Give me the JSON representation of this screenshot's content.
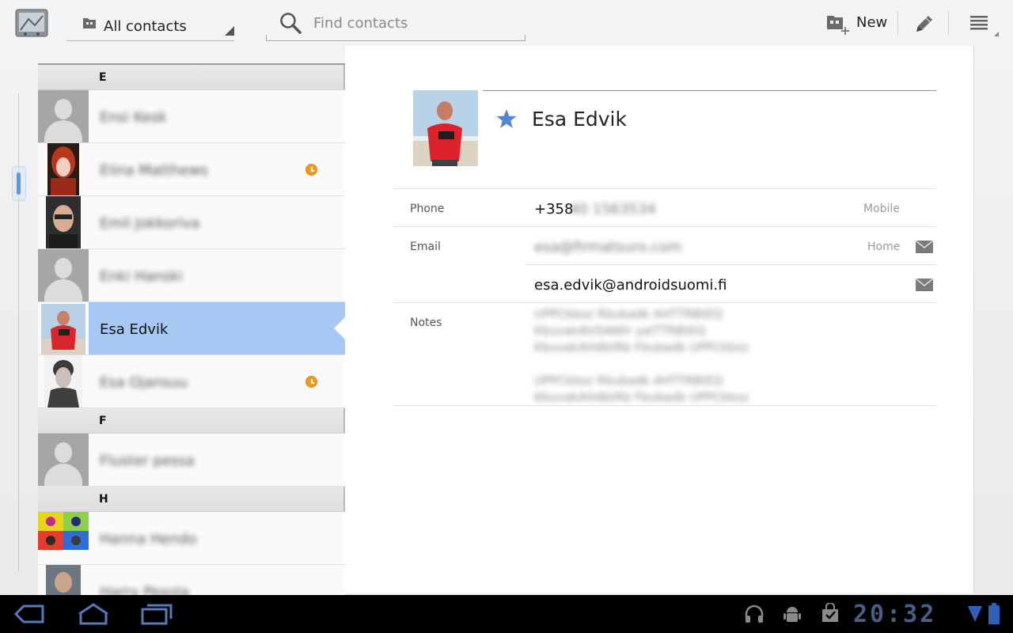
{
  "actionbar": {
    "account_filter": "All contacts",
    "search_placeholder": "Find contacts",
    "new_label": "New"
  },
  "list": {
    "sections": [
      {
        "letter": "E"
      },
      {
        "letter": "F"
      },
      {
        "letter": "H"
      }
    ],
    "rows_e": [
      {
        "name": "Ensi Kesk"
      },
      {
        "name": "Elina Matthews"
      },
      {
        "name": "Emil Jokkoriva"
      },
      {
        "name": "Enki Hanski"
      },
      {
        "name": "Esa Edvik"
      },
      {
        "name": "Esa Ojansuu"
      }
    ],
    "rows_f": [
      {
        "name": "Fluster pessa"
      }
    ],
    "rows_h": [
      {
        "name": "Hanna Hendo"
      },
      {
        "name": "Harry Pesola"
      }
    ]
  },
  "detail": {
    "name": "Esa Edvik",
    "phone": {
      "label": "Phone",
      "prefix": "+358",
      "number_blurred": "40 1563534",
      "type": "Mobile"
    },
    "email": {
      "label": "Email",
      "entries": [
        {
          "address": "esa@firmatsuro.com",
          "type": "Home"
        },
        {
          "address": "esa.edvik@androidsuomi.fi",
          "type": ""
        }
      ]
    },
    "notes": {
      "label": "Notes",
      "lines": [
        "UPPCkboz Rbubadk AHTTRBtEQ",
        "KbuvakAtrDAWlr yalTTRBtEQ",
        "KbuvakAHdbtRb Fbubadk UPPCkboz",
        "UPPCkboz Rbubadk AHTTRBtEQ",
        "KbuvakAHdbtRb Fbubadk UPPCkboz"
      ]
    }
  },
  "status": {
    "clock": "20:32"
  },
  "colors": {
    "selected_row": "#a7c8f2",
    "accent_blue": "#5c97dd",
    "recent_badge": "#f39a1c"
  }
}
